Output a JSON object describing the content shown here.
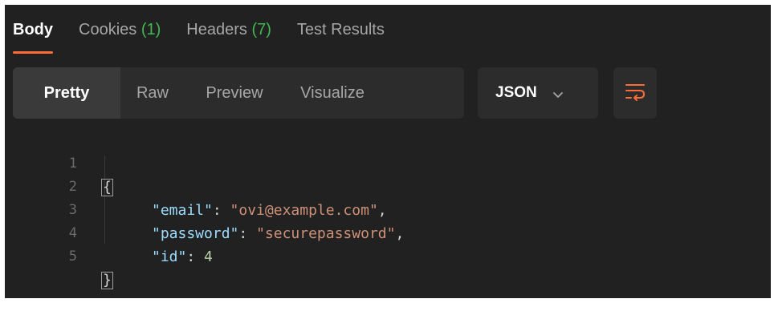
{
  "tabs": [
    {
      "label": "Body",
      "count": ""
    },
    {
      "label": "Cookies",
      "count": "(1)"
    },
    {
      "label": "Headers",
      "count": "(7)"
    },
    {
      "label": "Test Results",
      "count": ""
    }
  ],
  "active_tab": "Body",
  "view_modes": [
    "Pretty",
    "Raw",
    "Preview",
    "Visualize"
  ],
  "active_view": "Pretty",
  "language_select": {
    "value": "JSON"
  },
  "icons": {
    "chevron": "chevron-down-icon",
    "wrap": "word-wrap-icon"
  },
  "colors": {
    "accent": "#ff6c37",
    "count": "#3fb950",
    "key": "#9cdcfe",
    "string": "#ce9178",
    "number": "#b5cea8"
  },
  "code": {
    "line_numbers": [
      "1",
      "2",
      "3",
      "4",
      "5"
    ],
    "open_brace": "{",
    "close_brace": "}",
    "fields": [
      {
        "key": "\"email\"",
        "value": "\"ovi@example.com\"",
        "type": "string",
        "trailing": ","
      },
      {
        "key": "\"password\"",
        "value": "\"securepassword\"",
        "type": "string",
        "trailing": ","
      },
      {
        "key": "\"id\"",
        "value": "4",
        "type": "number",
        "trailing": ""
      }
    ],
    "colon": ": "
  }
}
